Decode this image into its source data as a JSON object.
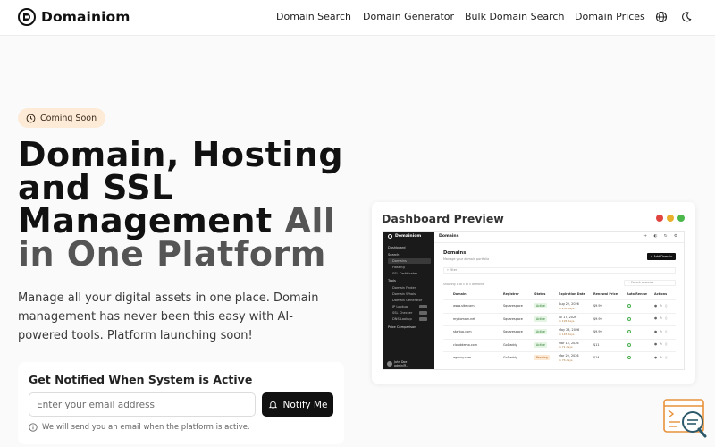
{
  "header": {
    "brand": "Domainiom",
    "nav": [
      "Domain Search",
      "Domain Generator",
      "Bulk Domain Search",
      "Domain Prices"
    ],
    "icons": [
      "globe-icon",
      "moon-icon"
    ]
  },
  "hero": {
    "badge": "Coming Soon",
    "title_line1": "Domain, Hosting",
    "title_line2": "and SSL",
    "title_line3_dark": "Management",
    "title_line3_muted": "All",
    "title_line4": "in One Platform",
    "description": "Manage all your digital assets in one place. Domain management has never been this easy with AI-powered tools. Platform launching soon!"
  },
  "notify": {
    "title": "Get Notified When System is Active",
    "placeholder": "Enter your email address",
    "button": "Notify Me",
    "help": "We will send you an email when the platform is active."
  },
  "preview": {
    "title": "Dashboard Preview",
    "dots": [
      "#e0443e",
      "#e9b02b",
      "#4cb84c"
    ],
    "sidebar": {
      "brand": "Domainiom",
      "items": [
        {
          "label": "Dashboard",
          "sub": false
        },
        {
          "label": "Search",
          "sub": false
        },
        {
          "label": "Domains",
          "sub": true,
          "active": true
        },
        {
          "label": "Hosting",
          "sub": true
        },
        {
          "label": "SSL Certificates",
          "sub": true
        },
        {
          "label": "Tools",
          "sub": false
        },
        {
          "label": "Domain Finder",
          "sub": true
        },
        {
          "label": "Domain Whois",
          "sub": true
        },
        {
          "label": "Domain Generator",
          "sub": true
        },
        {
          "label": "IP Lookup",
          "sub": true,
          "tag": true
        },
        {
          "label": "SSL Checker",
          "sub": true,
          "tag": true
        },
        {
          "label": "DNS Lookup",
          "sub": true,
          "tag": true
        },
        {
          "label": "Price Comparison",
          "sub": false
        }
      ],
      "user_name": "John Doe",
      "user_email": "admin@..."
    },
    "topbar": "Domains",
    "heading": "Domains",
    "subheading": "Manage your domain portfolio",
    "add_button": "+ Add Domain",
    "filter": "Filter",
    "showing": "Showing 1 to 5 of 5 domains",
    "search": "Search domains...",
    "columns": [
      "Domain",
      "Registrar",
      "Status",
      "Expiration Date",
      "Renewal Price",
      "Auto Renew",
      "Actions"
    ],
    "rows": [
      {
        "domain": "www.site.com",
        "registrar": "Squarespace",
        "status": "Active",
        "exp": "Aug 22, 2026",
        "exp_sub": "in 230 days",
        "price": "$9.99"
      },
      {
        "domain": "mydomain.net",
        "registrar": "Squarespace",
        "status": "Active",
        "exp": "Jul 17, 2026",
        "exp_sub": "in 195 days",
        "price": "$9.99"
      },
      {
        "domain": "startup.com",
        "registrar": "Squarespace",
        "status": "Active",
        "exp": "May 28, 2026",
        "exp_sub": "in 145 days",
        "price": "$9.99"
      },
      {
        "domain": "clouddemo.com",
        "registrar": "GoDaddy",
        "status": "Active",
        "exp": "Mar 15, 2026",
        "exp_sub": "in 71 days",
        "price": "$11"
      },
      {
        "domain": "agency.com",
        "registrar": "GoDaddy",
        "status": "Pending",
        "exp": "Mar 20, 2026",
        "exp_sub": "in 76 days",
        "price": "$14"
      }
    ]
  }
}
